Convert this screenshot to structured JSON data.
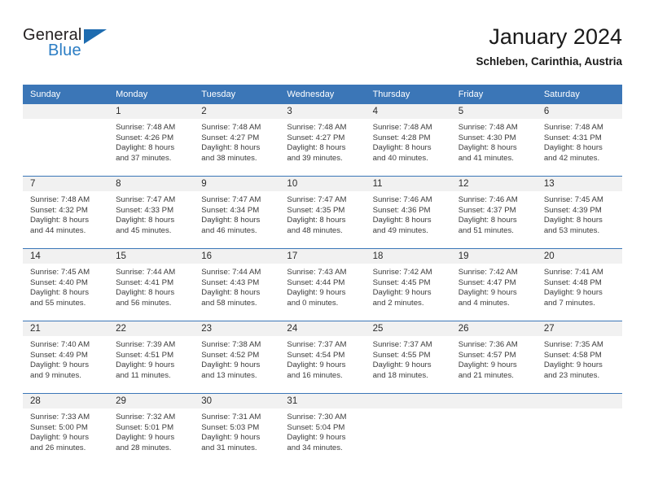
{
  "brand": {
    "word_one": "General",
    "word_two": "Blue",
    "triangle_icon": "triangle-icon"
  },
  "header": {
    "month_title": "January 2024",
    "location": "Schleben, Carinthia, Austria"
  },
  "colors": {
    "header_blue": "#3B76B7",
    "daynum_band": "#F1F1F1",
    "brand_blue": "#2B7DC4",
    "text": "#3B3B3B"
  },
  "weekday_headers": [
    "Sunday",
    "Monday",
    "Tuesday",
    "Wednesday",
    "Thursday",
    "Friday",
    "Saturday"
  ],
  "weeks": [
    [
      {
        "day": "",
        "sunrise": "",
        "sunset": "",
        "daylight": "",
        "empty": true
      },
      {
        "day": "1",
        "sunrise": "Sunrise: 7:48 AM",
        "sunset": "Sunset: 4:26 PM",
        "daylight": "Daylight: 8 hours and 37 minutes."
      },
      {
        "day": "2",
        "sunrise": "Sunrise: 7:48 AM",
        "sunset": "Sunset: 4:27 PM",
        "daylight": "Daylight: 8 hours and 38 minutes."
      },
      {
        "day": "3",
        "sunrise": "Sunrise: 7:48 AM",
        "sunset": "Sunset: 4:27 PM",
        "daylight": "Daylight: 8 hours and 39 minutes."
      },
      {
        "day": "4",
        "sunrise": "Sunrise: 7:48 AM",
        "sunset": "Sunset: 4:28 PM",
        "daylight": "Daylight: 8 hours and 40 minutes."
      },
      {
        "day": "5",
        "sunrise": "Sunrise: 7:48 AM",
        "sunset": "Sunset: 4:30 PM",
        "daylight": "Daylight: 8 hours and 41 minutes."
      },
      {
        "day": "6",
        "sunrise": "Sunrise: 7:48 AM",
        "sunset": "Sunset: 4:31 PM",
        "daylight": "Daylight: 8 hours and 42 minutes."
      }
    ],
    [
      {
        "day": "7",
        "sunrise": "Sunrise: 7:48 AM",
        "sunset": "Sunset: 4:32 PM",
        "daylight": "Daylight: 8 hours and 44 minutes."
      },
      {
        "day": "8",
        "sunrise": "Sunrise: 7:47 AM",
        "sunset": "Sunset: 4:33 PM",
        "daylight": "Daylight: 8 hours and 45 minutes."
      },
      {
        "day": "9",
        "sunrise": "Sunrise: 7:47 AM",
        "sunset": "Sunset: 4:34 PM",
        "daylight": "Daylight: 8 hours and 46 minutes."
      },
      {
        "day": "10",
        "sunrise": "Sunrise: 7:47 AM",
        "sunset": "Sunset: 4:35 PM",
        "daylight": "Daylight: 8 hours and 48 minutes."
      },
      {
        "day": "11",
        "sunrise": "Sunrise: 7:46 AM",
        "sunset": "Sunset: 4:36 PM",
        "daylight": "Daylight: 8 hours and 49 minutes."
      },
      {
        "day": "12",
        "sunrise": "Sunrise: 7:46 AM",
        "sunset": "Sunset: 4:37 PM",
        "daylight": "Daylight: 8 hours and 51 minutes."
      },
      {
        "day": "13",
        "sunrise": "Sunrise: 7:45 AM",
        "sunset": "Sunset: 4:39 PM",
        "daylight": "Daylight: 8 hours and 53 minutes."
      }
    ],
    [
      {
        "day": "14",
        "sunrise": "Sunrise: 7:45 AM",
        "sunset": "Sunset: 4:40 PM",
        "daylight": "Daylight: 8 hours and 55 minutes."
      },
      {
        "day": "15",
        "sunrise": "Sunrise: 7:44 AM",
        "sunset": "Sunset: 4:41 PM",
        "daylight": "Daylight: 8 hours and 56 minutes."
      },
      {
        "day": "16",
        "sunrise": "Sunrise: 7:44 AM",
        "sunset": "Sunset: 4:43 PM",
        "daylight": "Daylight: 8 hours and 58 minutes."
      },
      {
        "day": "17",
        "sunrise": "Sunrise: 7:43 AM",
        "sunset": "Sunset: 4:44 PM",
        "daylight": "Daylight: 9 hours and 0 minutes."
      },
      {
        "day": "18",
        "sunrise": "Sunrise: 7:42 AM",
        "sunset": "Sunset: 4:45 PM",
        "daylight": "Daylight: 9 hours and 2 minutes."
      },
      {
        "day": "19",
        "sunrise": "Sunrise: 7:42 AM",
        "sunset": "Sunset: 4:47 PM",
        "daylight": "Daylight: 9 hours and 4 minutes."
      },
      {
        "day": "20",
        "sunrise": "Sunrise: 7:41 AM",
        "sunset": "Sunset: 4:48 PM",
        "daylight": "Daylight: 9 hours and 7 minutes."
      }
    ],
    [
      {
        "day": "21",
        "sunrise": "Sunrise: 7:40 AM",
        "sunset": "Sunset: 4:49 PM",
        "daylight": "Daylight: 9 hours and 9 minutes."
      },
      {
        "day": "22",
        "sunrise": "Sunrise: 7:39 AM",
        "sunset": "Sunset: 4:51 PM",
        "daylight": "Daylight: 9 hours and 11 minutes."
      },
      {
        "day": "23",
        "sunrise": "Sunrise: 7:38 AM",
        "sunset": "Sunset: 4:52 PM",
        "daylight": "Daylight: 9 hours and 13 minutes."
      },
      {
        "day": "24",
        "sunrise": "Sunrise: 7:37 AM",
        "sunset": "Sunset: 4:54 PM",
        "daylight": "Daylight: 9 hours and 16 minutes."
      },
      {
        "day": "25",
        "sunrise": "Sunrise: 7:37 AM",
        "sunset": "Sunset: 4:55 PM",
        "daylight": "Daylight: 9 hours and 18 minutes."
      },
      {
        "day": "26",
        "sunrise": "Sunrise: 7:36 AM",
        "sunset": "Sunset: 4:57 PM",
        "daylight": "Daylight: 9 hours and 21 minutes."
      },
      {
        "day": "27",
        "sunrise": "Sunrise: 7:35 AM",
        "sunset": "Sunset: 4:58 PM",
        "daylight": "Daylight: 9 hours and 23 minutes."
      }
    ],
    [
      {
        "day": "28",
        "sunrise": "Sunrise: 7:33 AM",
        "sunset": "Sunset: 5:00 PM",
        "daylight": "Daylight: 9 hours and 26 minutes."
      },
      {
        "day": "29",
        "sunrise": "Sunrise: 7:32 AM",
        "sunset": "Sunset: 5:01 PM",
        "daylight": "Daylight: 9 hours and 28 minutes."
      },
      {
        "day": "30",
        "sunrise": "Sunrise: 7:31 AM",
        "sunset": "Sunset: 5:03 PM",
        "daylight": "Daylight: 9 hours and 31 minutes."
      },
      {
        "day": "31",
        "sunrise": "Sunrise: 7:30 AM",
        "sunset": "Sunset: 5:04 PM",
        "daylight": "Daylight: 9 hours and 34 minutes."
      },
      {
        "day": "",
        "sunrise": "",
        "sunset": "",
        "daylight": "",
        "empty": true
      },
      {
        "day": "",
        "sunrise": "",
        "sunset": "",
        "daylight": "",
        "empty": true
      },
      {
        "day": "",
        "sunrise": "",
        "sunset": "",
        "daylight": "",
        "empty": true
      }
    ]
  ]
}
